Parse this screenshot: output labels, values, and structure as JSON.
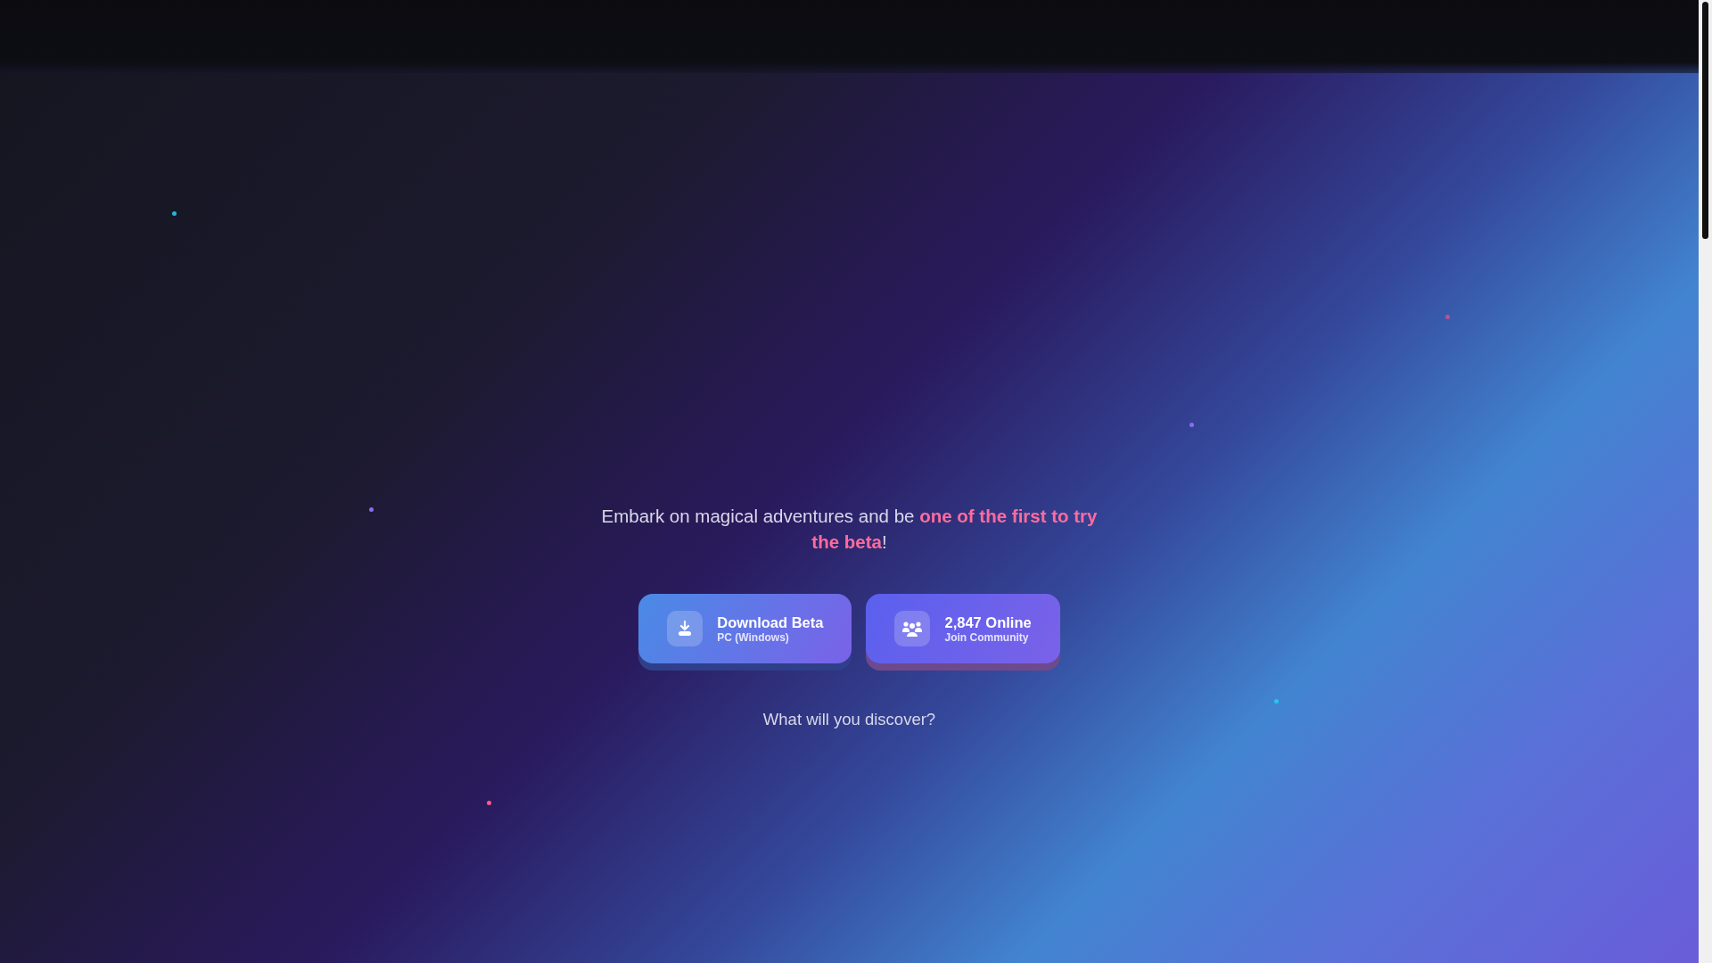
{
  "hero": {
    "tagline": "Embark on magical adventures and be **one of the first to try the beta**!",
    "buttons": [
      {
        "kind": "download",
        "title": "Download Beta",
        "subtitle": "PC (Windows)"
      },
      {
        "kind": "community",
        "title": "2,847 Online",
        "subtitle": "Join Community"
      }
    ],
    "prompt": "What will you discover?"
  }
}
